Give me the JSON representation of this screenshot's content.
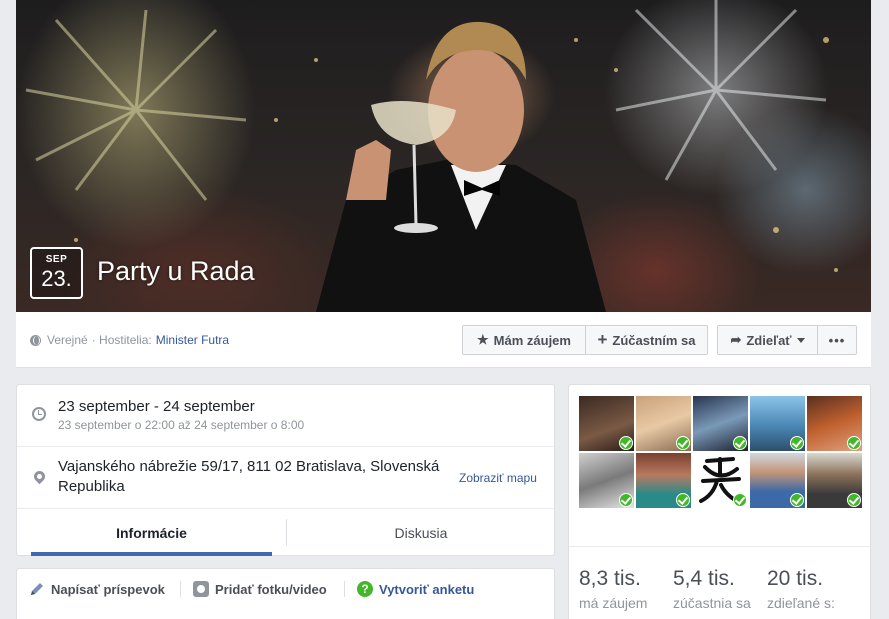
{
  "event": {
    "date_month": "SEP",
    "date_day": "23.",
    "title": "Party u Rada"
  },
  "action_bar": {
    "privacy": "Verejné",
    "hosted_by": "· Hostitelia:",
    "host": "Minister Futra",
    "interested_label": "Mám záujem",
    "going_label": "Zúčastním sa",
    "share_label": "Zdieľať",
    "more_label": "•••"
  },
  "info": {
    "date_main": "23 september - 24 september",
    "date_sub": "23 september o 22:00 až 24 september o 8:00",
    "address": "Vajanského nábrežie 59/17, 811 02 Bratislava, Slovenská Republika",
    "map_link": "Zobraziť mapu"
  },
  "tabs": [
    {
      "label": "Informácie",
      "active": true
    },
    {
      "label": "Diskusia",
      "active": false
    }
  ],
  "composer": {
    "write_post": "Napísať príspevok",
    "add_photo": "Pridať fotku/video",
    "create_poll": "Vytvoriť anketu"
  },
  "guests": {
    "avatar_count": 10,
    "stats": [
      {
        "value": "8,3 tis.",
        "label": "má záujem"
      },
      {
        "value": "5,4 tis.",
        "label": "zúčastnia sa"
      },
      {
        "value": "20 tis.",
        "label": "zdieľané s:"
      }
    ]
  },
  "colors": {
    "link": "#365899",
    "accent": "#4267b2",
    "check": "#42b72a"
  }
}
